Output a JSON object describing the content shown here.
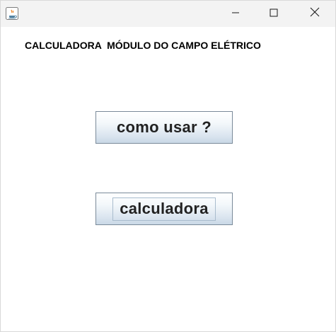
{
  "window": {
    "title": "",
    "controls": {
      "minimize": "minimize-icon",
      "maximize": "maximize-icon",
      "close": "close-icon"
    }
  },
  "main": {
    "heading": "CALCULADORA  MÓDULO DO CAMPO ELÉTRICO",
    "buttons": {
      "how_to_use": "como usar ?",
      "calculator": "calculadora"
    }
  },
  "colors": {
    "titlebar_bg": "#f3f3f3",
    "button_border": "#7a8a99",
    "button_text": "#222222"
  }
}
